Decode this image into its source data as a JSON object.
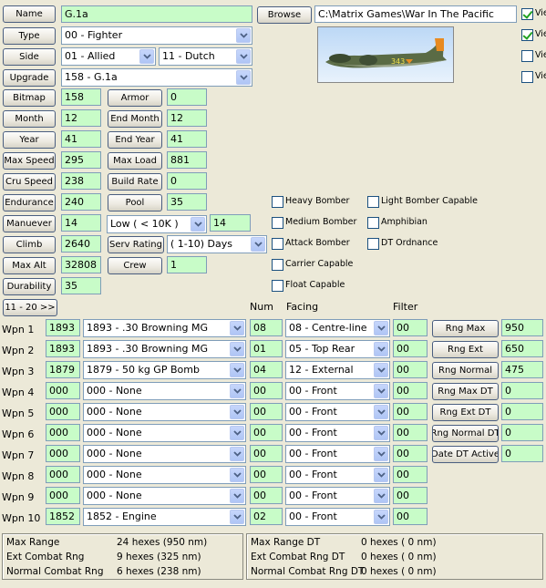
{
  "name": {
    "label": "Name",
    "value": "G.1a"
  },
  "browse": {
    "label": "Browse",
    "path": "C:\\Matrix Games\\War In The Pacific"
  },
  "view_checks": [
    {
      "label": "Vie",
      "checked": true
    },
    {
      "label": "Vie",
      "checked": true
    },
    {
      "label": "Vie",
      "checked": false
    },
    {
      "label": "Vie",
      "checked": false
    }
  ],
  "type": {
    "label": "Type",
    "value": "00 - Fighter"
  },
  "side": {
    "label": "Side",
    "value": "01 - Allied",
    "value2": "11 - Dutch"
  },
  "upgrade": {
    "label": "Upgrade",
    "value": "158 - G.1a"
  },
  "stats_left": [
    {
      "label": "Bitmap",
      "value": "158"
    },
    {
      "label": "Month",
      "value": "12"
    },
    {
      "label": "Year",
      "value": "41"
    },
    {
      "label": "Max Speed",
      "value": "295"
    },
    {
      "label": "Cru Speed",
      "value": "238"
    },
    {
      "label": "Endurance",
      "value": "240"
    },
    {
      "label": "Manuever",
      "value": "14"
    },
    {
      "label": "Climb",
      "value": "2640"
    },
    {
      "label": "Max Alt",
      "value": "32808"
    }
  ],
  "stats_mid": [
    {
      "label": "Armor",
      "value": "0"
    },
    {
      "label": "End Month",
      "value": "12"
    },
    {
      "label": "End Year",
      "value": "41"
    },
    {
      "label": "Max Load",
      "value": "881"
    },
    {
      "label": "Build Rate",
      "value": "0"
    },
    {
      "label": "Pool",
      "value": "35"
    }
  ],
  "durability": {
    "label": "Durability",
    "value": "35"
  },
  "manuever_alt": {
    "value": "Low    ( < 10K )",
    "num": "14"
  },
  "serv_rating": {
    "label": "Serv Rating",
    "value": "( 1-10)  Days"
  },
  "crew": {
    "label": "Crew",
    "value": "1"
  },
  "capabilities": [
    {
      "label": "Heavy Bomber"
    },
    {
      "label": "Medium Bomber"
    },
    {
      "label": "Attack Bomber"
    },
    {
      "label": "Carrier Capable"
    },
    {
      "label": "Float Capable"
    },
    {
      "label": "Light Bomber Capable"
    },
    {
      "label": "Amphibian"
    },
    {
      "label": "DT Ordnance"
    }
  ],
  "page_button": "11 - 20 >>",
  "headers": {
    "num": "Num",
    "facing": "Facing",
    "filter": "Filter"
  },
  "weapons": [
    {
      "label": "Wpn 1",
      "id": "1893",
      "name": "1893 - .30 Browning MG",
      "num": "08",
      "facing": "08 - Centre-line",
      "filter": "00"
    },
    {
      "label": "Wpn 2",
      "id": "1893",
      "name": "1893 - .30 Browning MG",
      "num": "01",
      "facing": "05 - Top Rear",
      "filter": "00"
    },
    {
      "label": "Wpn 3",
      "id": "1879",
      "name": "1879 - 50 kg GP Bomb",
      "num": "04",
      "facing": "12 - External",
      "filter": "00"
    },
    {
      "label": "Wpn 4",
      "id": "000",
      "name": "000 - None",
      "num": "00",
      "facing": "00 - Front",
      "filter": "00"
    },
    {
      "label": "Wpn 5",
      "id": "000",
      "name": "000 - None",
      "num": "00",
      "facing": "00 - Front",
      "filter": "00"
    },
    {
      "label": "Wpn 6",
      "id": "000",
      "name": "000 - None",
      "num": "00",
      "facing": "00 - Front",
      "filter": "00"
    },
    {
      "label": "Wpn 7",
      "id": "000",
      "name": "000 - None",
      "num": "00",
      "facing": "00 - Front",
      "filter": "00"
    },
    {
      "label": "Wpn 8",
      "id": "000",
      "name": "000 - None",
      "num": "00",
      "facing": "00 - Front",
      "filter": "00"
    },
    {
      "label": "Wpn 9",
      "id": "000",
      "name": "000 - None",
      "num": "00",
      "facing": "00 - Front",
      "filter": "00"
    },
    {
      "label": "Wpn 10",
      "id": "1852",
      "name": "1852 - Engine",
      "num": "02",
      "facing": "00 - Front",
      "filter": "00"
    }
  ],
  "ranges": [
    {
      "label": "Rng Max",
      "value": "950"
    },
    {
      "label": "Rng Ext",
      "value": "650"
    },
    {
      "label": "Rng Normal",
      "value": "475"
    },
    {
      "label": "Rng Max DT",
      "value": "0"
    },
    {
      "label": "Rng Ext DT",
      "value": "0"
    },
    {
      "label": "Rng Normal DT",
      "value": "0"
    },
    {
      "label": "Date DT Active",
      "value": "0"
    }
  ],
  "summary_left": [
    {
      "label": "Max Range",
      "value": "24 hexes (950 nm)"
    },
    {
      "label": "Ext Combat Rng",
      "value": "9 hexes (325 nm)"
    },
    {
      "label": "Normal Combat Rng",
      "value": "6 hexes (238 nm)"
    }
  ],
  "summary_right": [
    {
      "label": "Max Range DT",
      "value": "0 hexes ( 0 nm)"
    },
    {
      "label": "Ext Combat Rng DT",
      "value": "0 hexes ( 0 nm)"
    },
    {
      "label": "Normal Combat Rng DT",
      "value": "0 hexes ( 0 nm)"
    }
  ],
  "colors": {
    "field_green": "#c8fcc8",
    "background": "#ece9d8",
    "accent": "#7f9db9"
  }
}
